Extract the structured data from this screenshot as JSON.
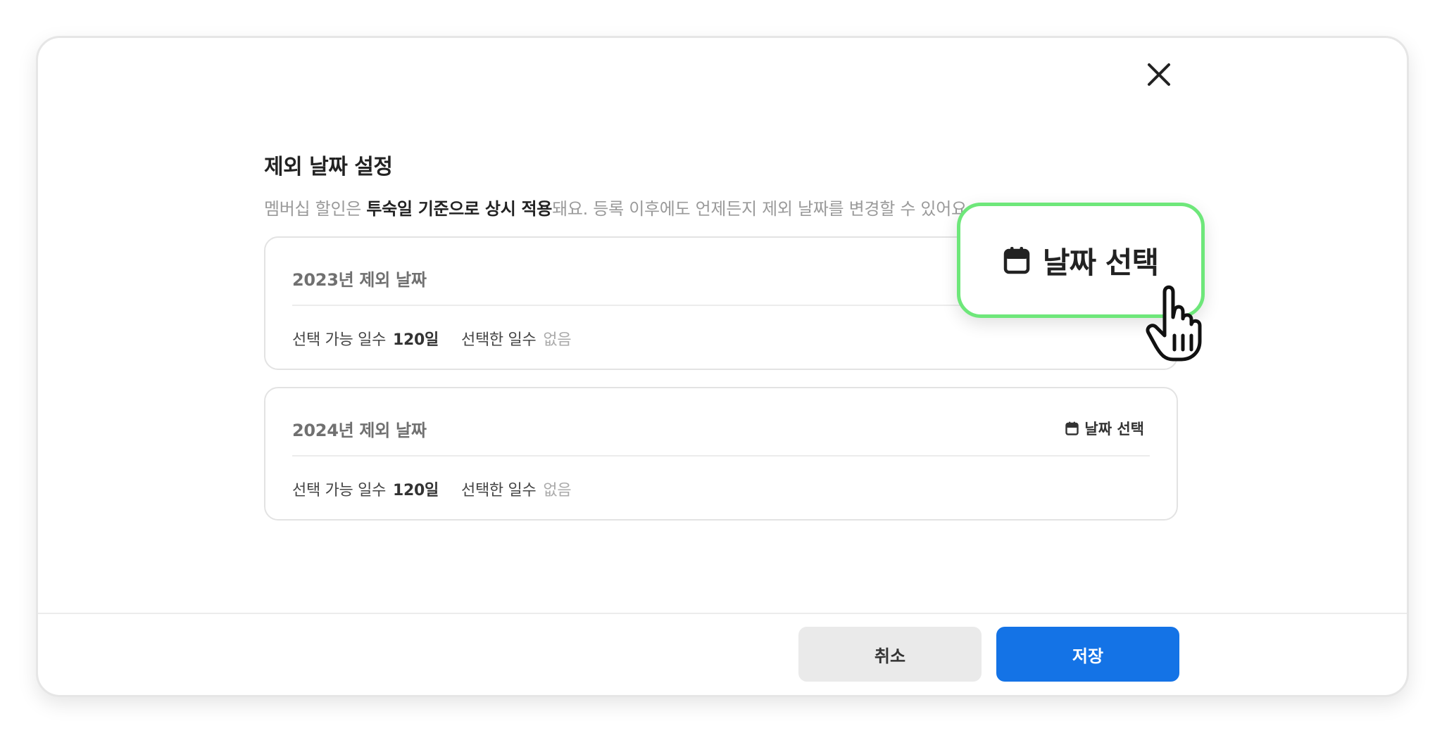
{
  "dialog": {
    "title": "제외 날짜 설정",
    "subtitle_prefix": "멤버십 할인은 ",
    "subtitle_bold": "투숙일 기준으로 상시 적용",
    "subtitle_suffix": "돼요. 등록 이후에도 언제든지 제외 날짜를 변경할 수 있어요."
  },
  "year_cards": [
    {
      "title": "2023년 제외 날짜",
      "available_label": "선택 가능 일수",
      "available_value": "120일",
      "selected_label": "선택한 일수",
      "selected_value": "없음",
      "date_button_label": "날짜 선택"
    },
    {
      "title": "2024년 제외 날짜",
      "available_label": "선택 가능 일수",
      "available_value": "120일",
      "selected_label": "선택한 일수",
      "selected_value": "없음",
      "date_button_label": "날짜 선택"
    }
  ],
  "footer": {
    "cancel_label": "취소",
    "save_label": "저장"
  },
  "callout": {
    "label": "날짜 선택"
  },
  "icons": {
    "close": "close-icon",
    "calendar": "calendar-icon",
    "cursor": "hand-pointer-cursor-icon"
  },
  "colors": {
    "primary": "#1473e6",
    "highlight": "#6ee77a"
  }
}
